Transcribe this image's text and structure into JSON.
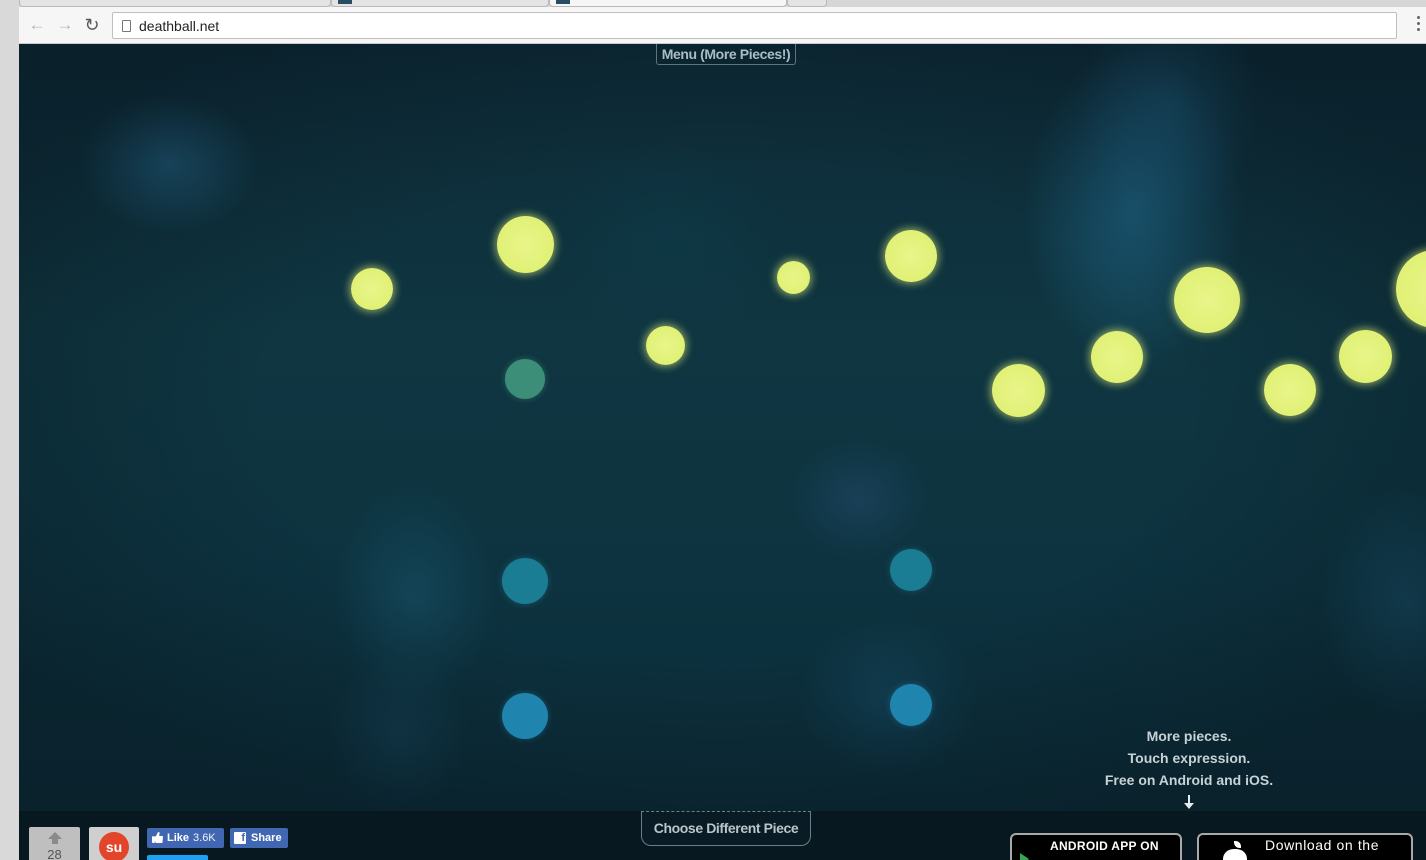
{
  "browser": {
    "url": "deathball.net",
    "back_icon": "back-arrow-icon",
    "forward_icon": "forward-arrow-icon",
    "reload_icon": "reload-icon",
    "menu_icon": "kebab-menu-icon"
  },
  "page": {
    "menu_label": "Menu (More Pieces!)",
    "choose_label": "Choose Different Piece",
    "promo_lines": [
      "More pieces.",
      "Touch expression.",
      "Free on Android and iOS."
    ],
    "upvote_count": "28",
    "fb_like_label": "Like",
    "fb_like_count": "3.6K",
    "fb_share_label": "Share",
    "android_badge": "ANDROID APP ON",
    "apple_badge": "Download on the"
  },
  "colors": {
    "dot_yellow": "#e3f27a",
    "dot_green": "#3d8e78",
    "dot_teal": "#1b7d93",
    "dot_blue": "#1f85ae",
    "background": "#0f3641"
  }
}
